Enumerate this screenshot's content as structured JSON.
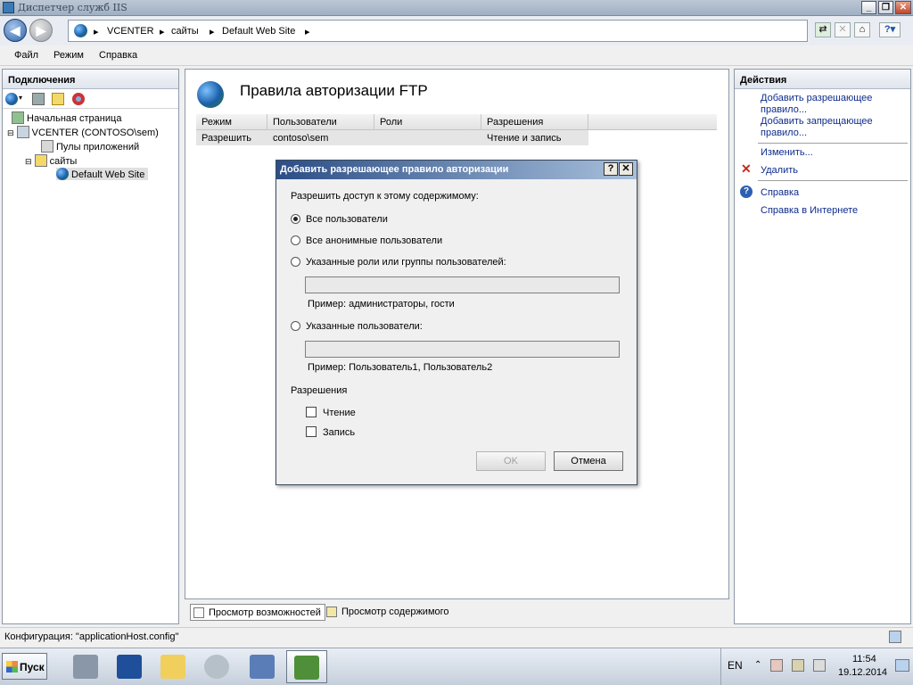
{
  "window": {
    "title": "Диспетчер служб IIS"
  },
  "address": {
    "crumbs": [
      "VCENTER",
      "сайты",
      "Default Web Site"
    ]
  },
  "menu": {
    "file": "Файл",
    "view": "Режим",
    "help": "Справка"
  },
  "connections": {
    "title": "Подключения",
    "tree": [
      {
        "label": "Начальная страница"
      },
      {
        "label": "VCENTER (CONTOSO\\sem)"
      },
      {
        "label": "Пулы приложений"
      },
      {
        "label": "сайты"
      },
      {
        "label": "Default Web Site"
      }
    ]
  },
  "main": {
    "title": "Правила авторизации FTP",
    "columns": [
      "Режим",
      "Пользователи",
      "Роли",
      "Разрешения"
    ],
    "rows": [
      {
        "mode": "Разрешить",
        "users": "contoso\\sem",
        "roles": "",
        "perms": "Чтение и запись"
      }
    ]
  },
  "bottom_tabs": {
    "features": "Просмотр возможностей",
    "content": "Просмотр содержимого"
  },
  "actions": {
    "title": "Действия",
    "add_allow": "Добавить разрешающее правило...",
    "add_deny": "Добавить запрещающее правило...",
    "edit": "Изменить...",
    "delete": "Удалить",
    "help": "Справка",
    "online_help": "Справка в Интернете"
  },
  "dialog": {
    "title": "Добавить разрешающее правило авторизации",
    "prompt": "Разрешить доступ к этому содержимому:",
    "opt_all": "Все пользователи",
    "opt_anon": "Все анонимные пользователи",
    "opt_roles": "Указанные роли или группы пользователей:",
    "roles_example": "Пример: администраторы, гости",
    "opt_users": "Указанные пользователи:",
    "users_example": "Пример: Пользователь1, Пользователь2",
    "perm_title": "Разрешения",
    "perm_read": "Чтение",
    "perm_write": "Запись",
    "ok": "OK",
    "cancel": "Отмена",
    "selected_option": "Все пользователи"
  },
  "status": {
    "text": "Конфигурация: \"applicationHost.config\""
  },
  "taskbar": {
    "start": "Пуск",
    "lang": "EN",
    "time": "11:54",
    "date": "19.12.2014"
  }
}
